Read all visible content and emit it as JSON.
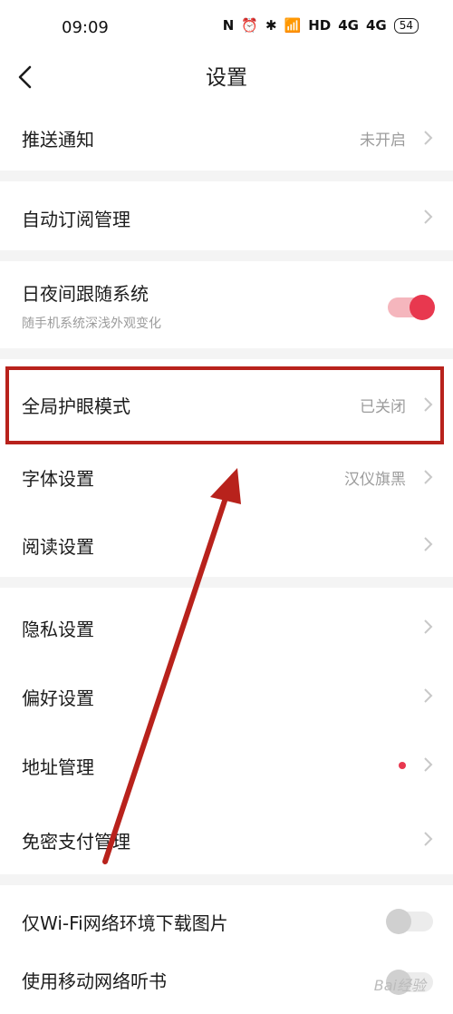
{
  "status": {
    "time": "09:09",
    "icons": [
      "N",
      "⏰",
      "✱",
      "📶",
      "HD",
      "4G",
      "4G"
    ],
    "battery": "54"
  },
  "header": {
    "title": "设置"
  },
  "sections": {
    "push": {
      "label": "推送通知",
      "value": "未开启"
    },
    "subscribe": {
      "label": "自动订阅管理"
    },
    "night": {
      "label": "日夜间跟随系统",
      "desc": "随手机系统深浅外观变化",
      "toggle_state": "on"
    },
    "eye": {
      "label": "全局护眼模式",
      "value": "已关闭"
    },
    "font": {
      "label": "字体设置",
      "value": "汉仪旗黑"
    },
    "read": {
      "label": "阅读设置"
    },
    "privacy": {
      "label": "隐私设置"
    },
    "prefs": {
      "label": "偏好设置"
    },
    "address": {
      "label": "地址管理"
    },
    "nopwd": {
      "label": "免密支付管理"
    },
    "wifi": {
      "label": "仅Wi-Fi网络环境下载图片",
      "toggle_state": "off"
    },
    "mobile": {
      "label": "使用移动网络听书",
      "toggle_state": "off"
    }
  },
  "watermark": "Bai经验",
  "colors": {
    "accent": "#e8384f",
    "highlight_box": "#b8221c"
  }
}
